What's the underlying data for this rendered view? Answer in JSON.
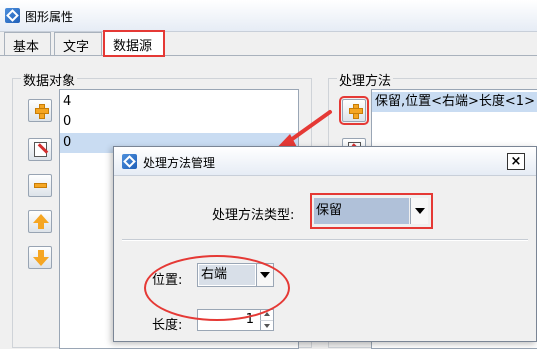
{
  "window": {
    "title": "图形属性",
    "icon": "app-diamond-icon"
  },
  "tabs": [
    {
      "label": "基本"
    },
    {
      "label": "文字"
    },
    {
      "label": "数据源",
      "selected": true
    }
  ],
  "data_objects": {
    "label": "数据对象",
    "items": [
      "4",
      "0",
      "0"
    ],
    "selected_index": 2
  },
  "processing": {
    "label": "处理方法",
    "items": [
      "保留,位置<右端>长度<1>"
    ]
  },
  "dialog": {
    "title": "处理方法管理",
    "close_label": "×",
    "method_type_label": "处理方法类型:",
    "method_type_value": "保留",
    "position_label": "位置:",
    "position_value": "右端",
    "length_label": "长度:",
    "length_value": "1"
  },
  "colors": {
    "annotation": "#e53935",
    "selection": "#c9dcf2",
    "icon_accent": "#f5a623"
  }
}
